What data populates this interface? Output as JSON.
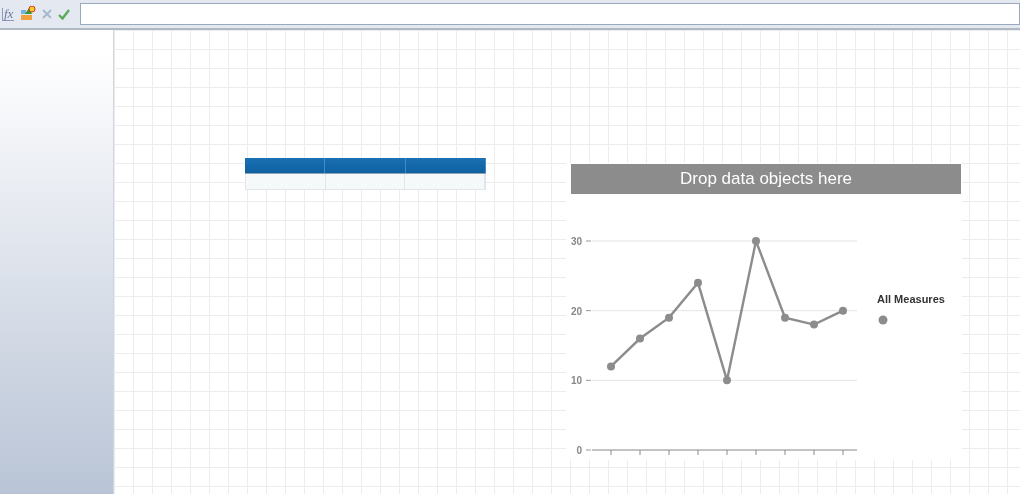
{
  "toolbar": {
    "formula_label": "fx"
  },
  "chart_panel": {
    "drop_zone_label": "Drop data objects here",
    "chart_data": {
      "type": "line",
      "ylim": [
        0,
        30
      ],
      "yticks": [
        0,
        10,
        20,
        30
      ],
      "series": [
        {
          "name": "All Measures",
          "color": "#8c8c8c",
          "marker": true,
          "values": [
            12,
            16,
            19,
            24,
            10,
            30,
            19,
            18,
            20
          ]
        }
      ]
    }
  }
}
